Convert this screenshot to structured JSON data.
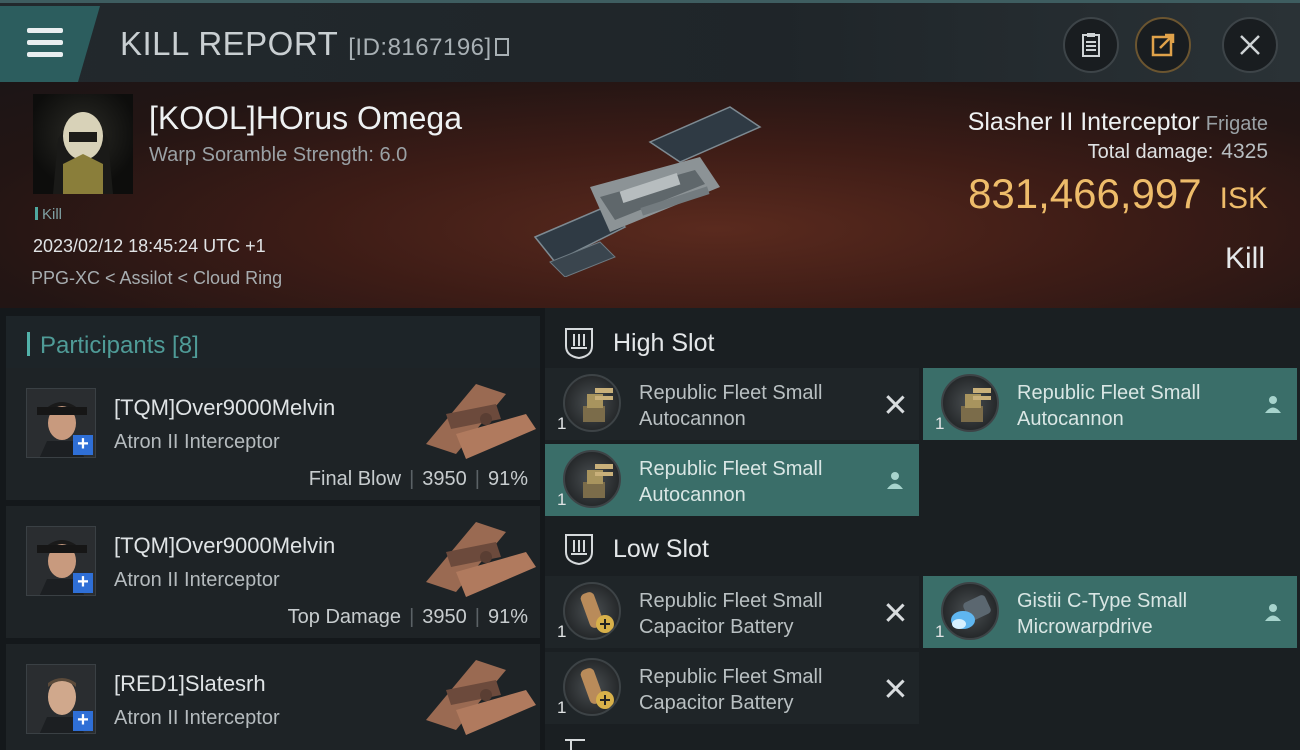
{
  "header": {
    "title": "KILL REPORT",
    "report_id": "[ID:8167196]",
    "buttons": [
      "clipboard",
      "share",
      "close"
    ]
  },
  "victim": {
    "name": "[KOOL]HOrus Omega",
    "warp_scramble": "Warp Soramble Strength: 6.0",
    "tag": "Kill",
    "datetime": "2023/02/12 18:45:24 UTC +1",
    "location": "PPG-XC < Assilot < Cloud Ring",
    "ship": "Slasher II Interceptor",
    "ship_class": "Frigate",
    "total_damage_label": "Total damage:",
    "total_damage": "4325",
    "isk_value": "831,466,997",
    "isk_unit": "ISK",
    "result": "Kill"
  },
  "participants": {
    "heading": "Participants [8]",
    "rows": [
      {
        "name": "[TQM]Over9000Melvin",
        "ship": "Atron II Interceptor",
        "role": "Final Blow",
        "damage": "3950",
        "percent": "91%"
      },
      {
        "name": "[TQM]Over9000Melvin",
        "ship": "Atron II Interceptor",
        "role": "Top Damage",
        "damage": "3950",
        "percent": "91%"
      },
      {
        "name": "[RED1]Slatesrh",
        "ship": "Atron II Interceptor"
      }
    ]
  },
  "fittings": {
    "high_slot": {
      "title": "High Slot",
      "modules": [
        {
          "qty": "1",
          "name": "Republic Fleet Small Autocannon",
          "status": "destroyed"
        },
        {
          "qty": "1",
          "name": "Republic Fleet Small Autocannon",
          "status": "dropped"
        },
        {
          "qty": "1",
          "name": "Republic Fleet Small Autocannon",
          "status": "dropped"
        }
      ]
    },
    "low_slot": {
      "title": "Low Slot",
      "modules": [
        {
          "qty": "1",
          "name": "Republic Fleet Small Capacitor Battery",
          "status": "destroyed"
        },
        {
          "qty": "1",
          "name": "Gistii C-Type Small Microwarpdrive",
          "status": "dropped"
        },
        {
          "qty": "1",
          "name": "Republic Fleet Small Capacitor Battery",
          "status": "destroyed"
        }
      ]
    }
  },
  "colors": {
    "accent_teal": "#3a6e69",
    "isk_gold": "#eebc6a",
    "header_teal": "#2c5d5e"
  },
  "icons": [
    "menu-icon",
    "copy-icon",
    "clipboard-icon",
    "share-icon",
    "close-icon",
    "slot-icon",
    "close-x-icon",
    "person-icon",
    "add-contact-icon"
  ]
}
